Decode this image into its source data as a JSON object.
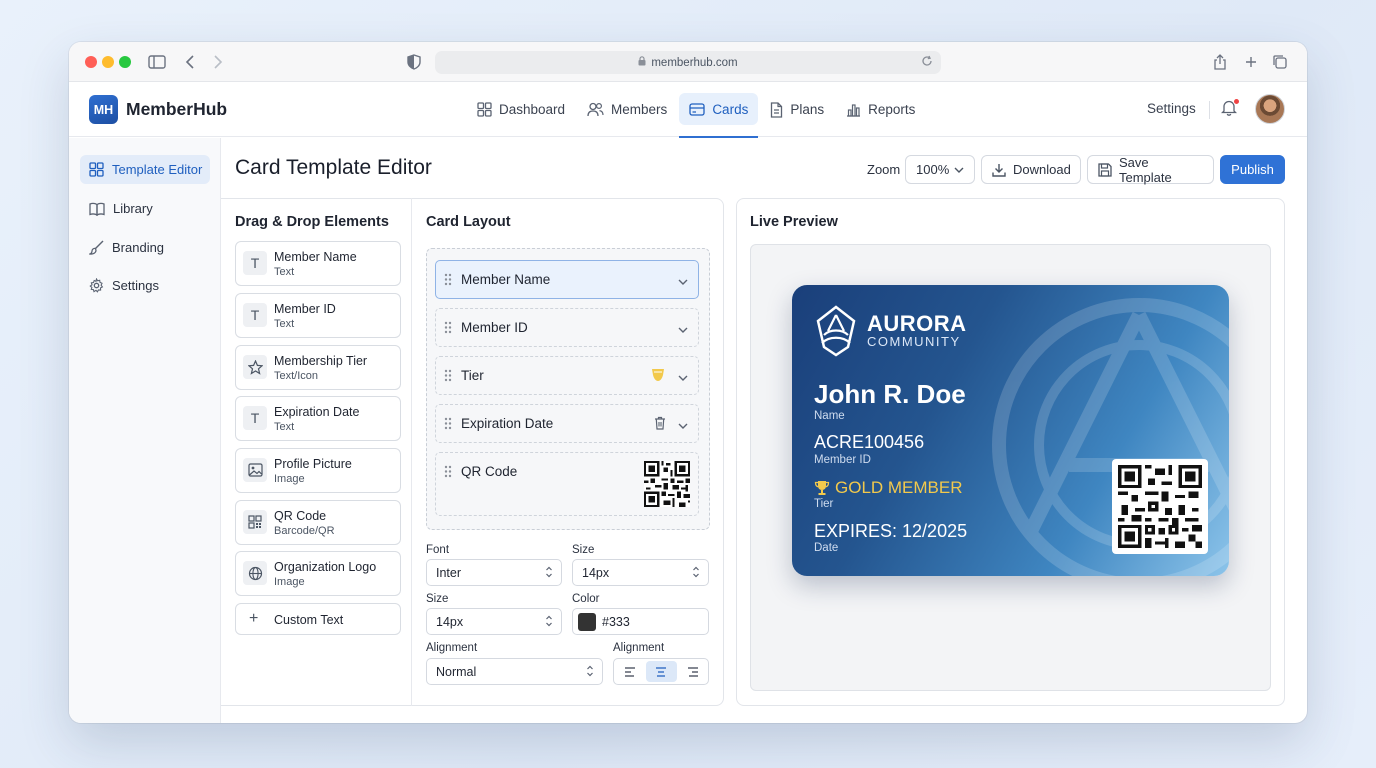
{
  "browser": {
    "url": "memberhub.com"
  },
  "app": {
    "logo_initials": "MH",
    "name": "MemberHub",
    "nav": [
      {
        "label": "Dashboard",
        "icon": "grid-icon"
      },
      {
        "label": "Members",
        "icon": "users-icon"
      },
      {
        "label": "Cards",
        "icon": "card-icon",
        "active": true
      },
      {
        "label": "Plans",
        "icon": "document-icon"
      },
      {
        "label": "Reports",
        "icon": "bar-chart-icon"
      }
    ],
    "settings_label": "Settings"
  },
  "sidebar": {
    "items": [
      {
        "label": "Template Editor",
        "icon": "grid-icon",
        "active": true
      },
      {
        "label": "Library",
        "icon": "book-icon"
      },
      {
        "label": "Branding",
        "icon": "brush-icon"
      },
      {
        "label": "Settings",
        "icon": "gear-icon"
      }
    ]
  },
  "page": {
    "title": "Card Template Editor",
    "zoom_label": "Zoom",
    "zoom_value": "100%",
    "download_label": "Download",
    "save_label": "Save Template",
    "publish_label": "Publish"
  },
  "elements": {
    "title": "Drag & Drop Elements",
    "items": [
      {
        "name": "Member Name",
        "type": "Text",
        "icon": "text-icon"
      },
      {
        "name": "Member ID",
        "type": "Text",
        "icon": "text-icon"
      },
      {
        "name": "Membership Tier",
        "type": "Text/Icon",
        "icon": "star-icon"
      },
      {
        "name": "Expiration Date",
        "type": "Text",
        "icon": "text-icon"
      },
      {
        "name": "Profile Picture",
        "type": "Image",
        "icon": "image-icon"
      },
      {
        "name": "QR Code",
        "type": "Barcode/QR",
        "icon": "qr-icon"
      },
      {
        "name": "Organization Logo",
        "type": "Image",
        "icon": "globe-icon"
      }
    ],
    "custom_text": "Custom Text"
  },
  "layout": {
    "title": "Card Layout",
    "rows": [
      {
        "label": "Member Name"
      },
      {
        "label": "Member ID"
      },
      {
        "label": "Tier"
      },
      {
        "label": "Expiration Date"
      },
      {
        "label": "QR Code"
      }
    ],
    "props": {
      "font_label": "Font",
      "font_value": "Inter",
      "size_label": "Size",
      "size_value": "14px",
      "size2_label": "Size",
      "size2_value": "14px",
      "color_label": "Color",
      "color_value": "#333",
      "alignment_label": "Alignment",
      "alignment_value": "Normal",
      "alignment2_label": "Alignment"
    }
  },
  "preview": {
    "title": "Live Preview",
    "card": {
      "brand": "AURORA",
      "brand_sub": "COMMUNITY",
      "name": "John R. Doe",
      "name_label": "Name",
      "id": "ACRE100456",
      "id_label": "Member ID",
      "tier": "GOLD MEMBER",
      "tier_label": "Tier",
      "expires": "EXPIRES: 12/2025",
      "expires_label": "Date"
    }
  },
  "colors": {
    "accent": "#2f72d6",
    "tier_gold": "#f2c94c",
    "card_dark": "#1a3f7a"
  }
}
